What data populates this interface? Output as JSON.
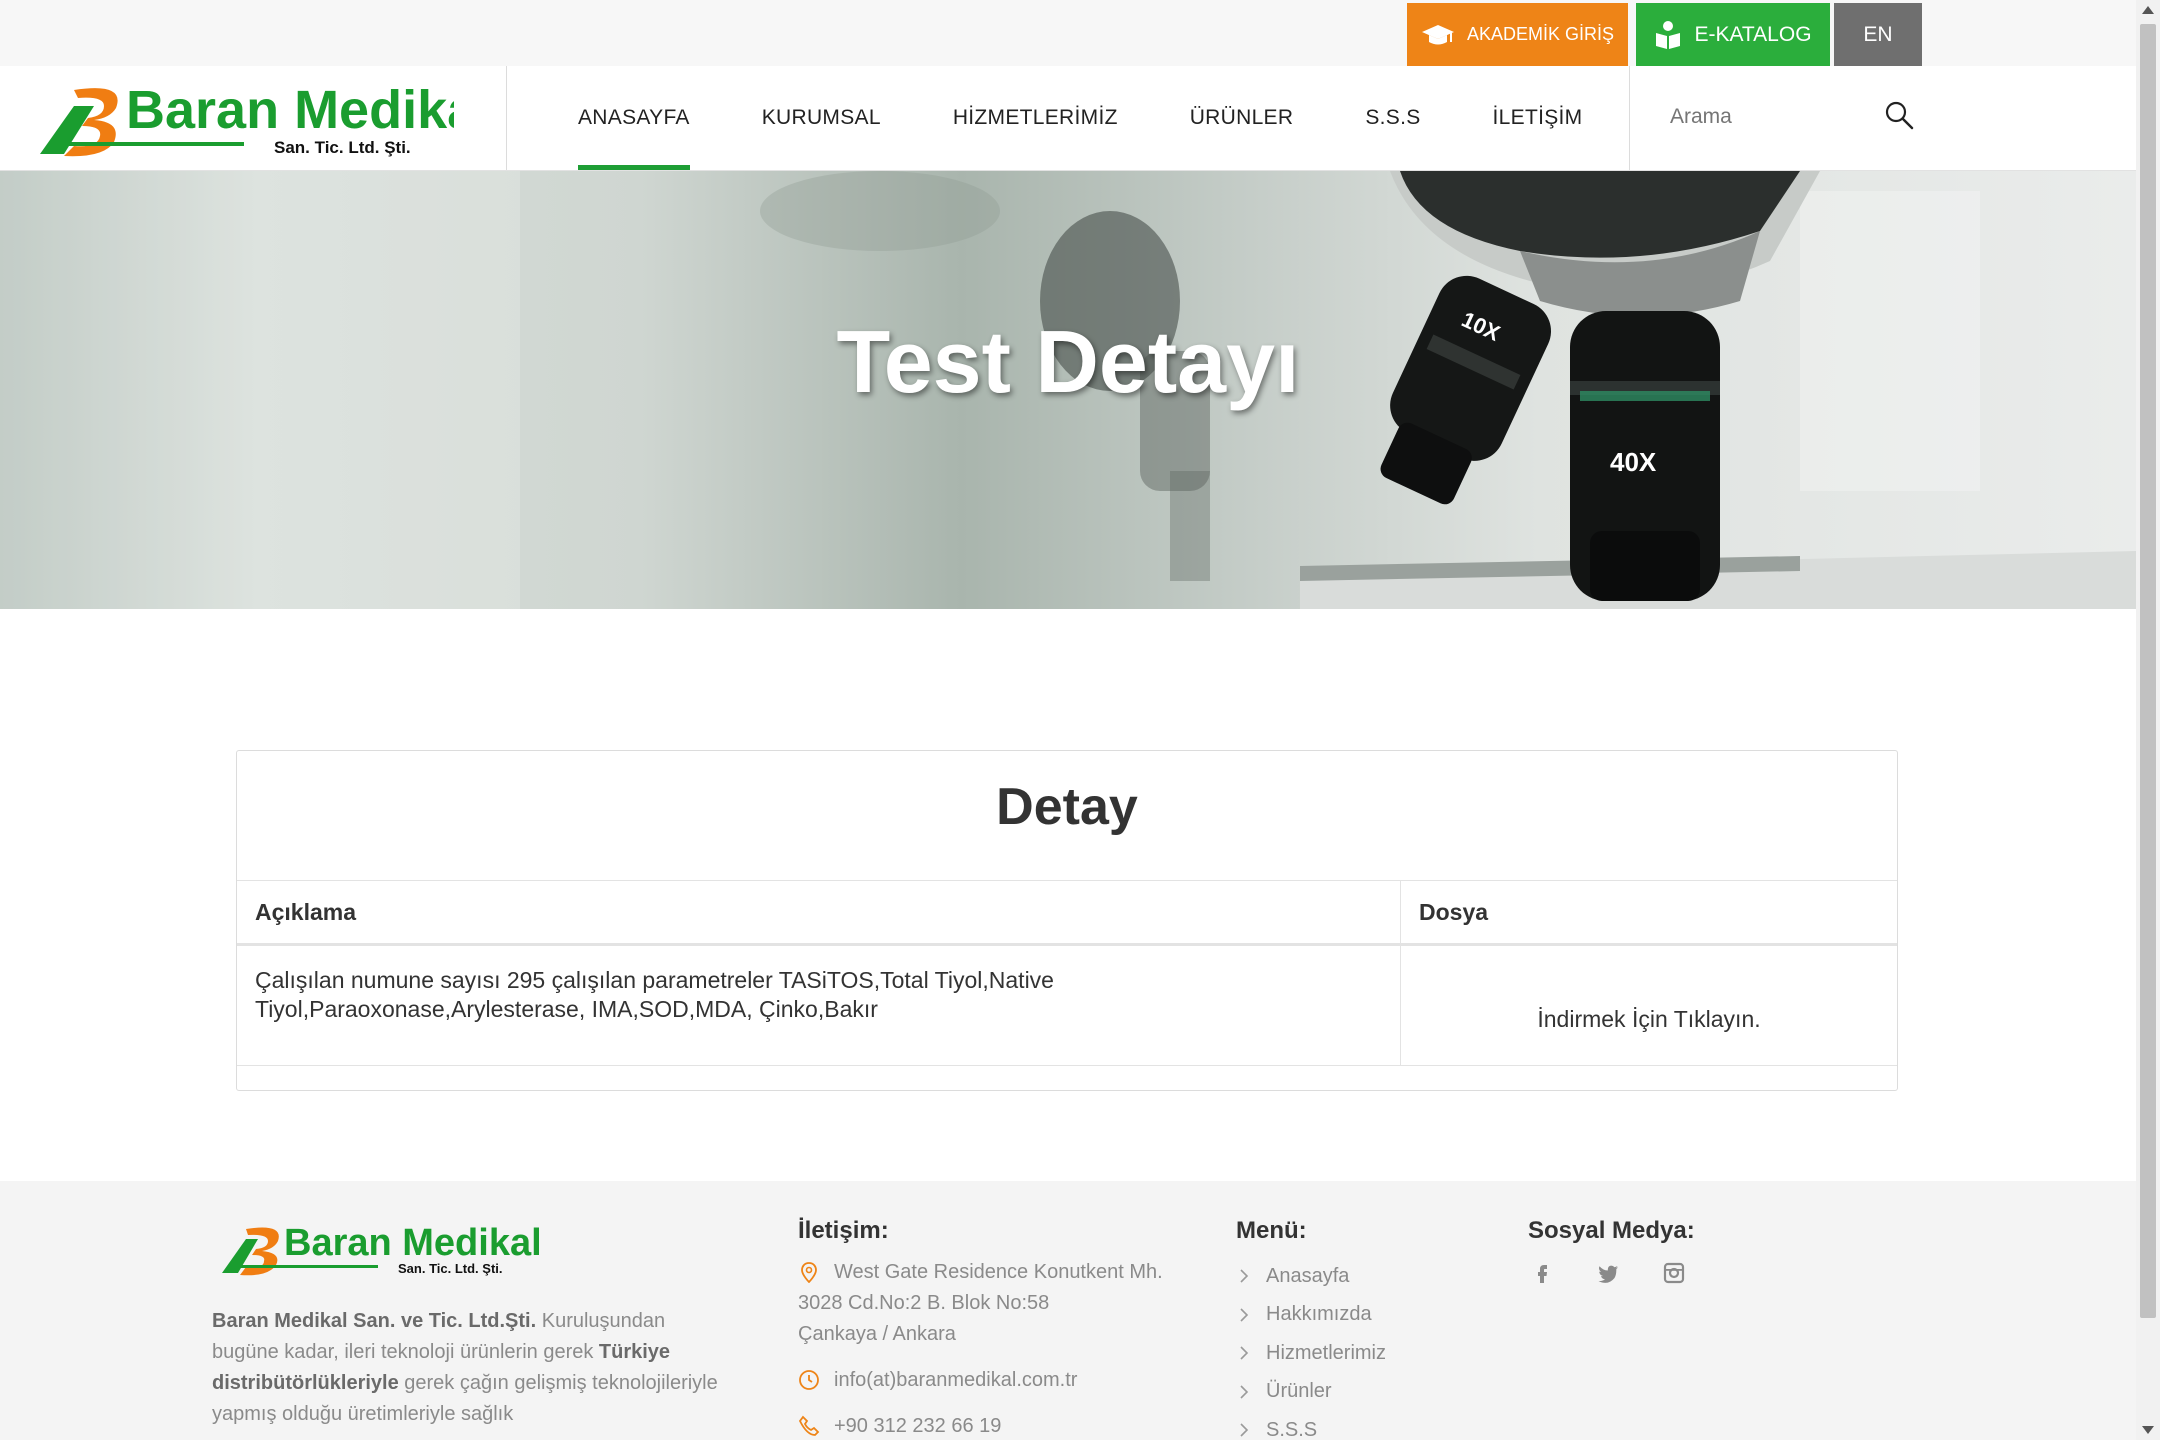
{
  "topbar": {
    "akademik_label": "AKADEMİK GİRİŞ",
    "katalog_label": "E-KATALOG",
    "lang_label": "EN"
  },
  "header": {
    "logo_text": "Baran Medikal",
    "logo_subtext": "San. Tic. Ltd. Şti.",
    "nav": [
      {
        "label": "ANASAYFA",
        "active": true
      },
      {
        "label": "KURUMSAL"
      },
      {
        "label": "HİZMETLERİMİZ"
      },
      {
        "label": "ÜRÜNLER"
      },
      {
        "label": "S.S.S"
      },
      {
        "label": "İLETİŞİM"
      }
    ],
    "search_placeholder": "Arama"
  },
  "hero": {
    "title": "Test Detayı",
    "microscope_labels": [
      "10X",
      "40X"
    ]
  },
  "detail": {
    "title": "Detay",
    "col_description": "Açıklama",
    "col_file": "Dosya",
    "row": {
      "description": "Çalışılan numune sayısı 295 çalışılan parametreler TASiTOS,Total Tiyol,Native Tiyol,Paraoxonase,Arylesterase, IMA,SOD,MDA, Çinko,Bakır",
      "file_link": "İndirmek İçin Tıklayın."
    }
  },
  "footer": {
    "logo_text": "Baran Medikal",
    "logo_subtext": "San. Tic. Ltd. Şti.",
    "about_bold1": "Baran Medikal San. ve Tic. Ltd.Şti.",
    "about_text1": " Kuruluşundan bugüne kadar, ileri teknoloji ürünlerin gerek ",
    "about_bold2": "Türkiye distribütörlükleriyle",
    "about_text2": " gerek çağın gelişmiş teknolojileriyle yapmış olduğu üretimleriyle sağlık",
    "contact_heading": "İletişim:",
    "address_line1": "West Gate Residence Konutkent Mh.",
    "address_line2": "3028 Cd.No:2 B. Blok No:58",
    "address_line3": "Çankaya / Ankara",
    "email": "info(at)baranmedikal.com.tr",
    "phone": "+90 312 232 66 19",
    "menu_heading": "Menü:",
    "menu": [
      "Anasayfa",
      "Hakkımızda",
      "Hizmetlerimiz",
      "Ürünler",
      "S.S.S"
    ],
    "social_heading": "Sosyal Medya:",
    "social_icons": [
      "facebook-icon",
      "twitter-icon",
      "instagram-icon"
    ]
  },
  "colors": {
    "akademik": "#ee8417",
    "katalog": "#2bae3c",
    "lang": "#6f6f6f",
    "nav_active": "#1e9e35",
    "logo_green": "#1a9d2f",
    "logo_orange": "#f07d12"
  }
}
